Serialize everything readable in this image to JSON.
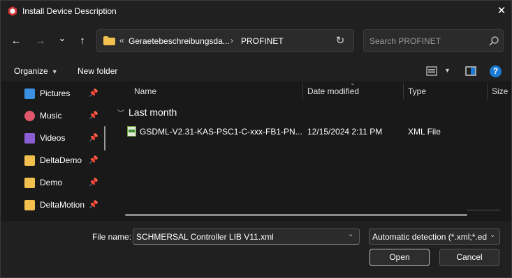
{
  "window": {
    "title": "Install Device Description",
    "close_glyph": "✕"
  },
  "nav": {
    "back_glyph": "←",
    "forward_glyph": "→",
    "recent_glyph": "⌄",
    "up_glyph": "↑"
  },
  "address": {
    "overflow_glyph": "«",
    "crumbs": [
      "Geraetebeschreibungsda...",
      "PROFINET"
    ],
    "separator_glyph": "›",
    "refresh_glyph": "↻"
  },
  "search": {
    "placeholder": "Search PROFINET"
  },
  "commandbar": {
    "organize_label": "Organize",
    "new_folder_label": "New folder",
    "help_label": "?"
  },
  "sidebar": {
    "items": [
      {
        "label": "Pictures",
        "icon": "pictures-icon",
        "color": "#3b8fe0"
      },
      {
        "label": "Music",
        "icon": "music-icon",
        "color": "#e0566b"
      },
      {
        "label": "Videos",
        "icon": "videos-icon",
        "color": "#8a5fd4"
      },
      {
        "label": "DeltaDemo",
        "icon": "folder-icon",
        "color": "#f2c04f"
      },
      {
        "label": "Demo",
        "icon": "folder-icon",
        "color": "#f2c04f"
      },
      {
        "label": "DeltaMotion",
        "icon": "folder-icon",
        "color": "#f2c04f"
      }
    ],
    "pin_glyph": "📌"
  },
  "columns": {
    "name": "Name",
    "date_modified": "Date modified",
    "type": "Type",
    "size": "Size"
  },
  "groups": [
    {
      "label": "Last month",
      "files": [
        {
          "name": "GSDML-V2.31-KAS-PSC1-C-xxx-FB1-PN...",
          "date_modified": "12/15/2024 2:11 PM",
          "type": "XML File",
          "icon": "xml-file-icon"
        }
      ]
    }
  ],
  "footer": {
    "file_name_label": "File name:",
    "file_name_value": "SCHMERSAL Controller LIB V11.xml",
    "filter_value": "Automatic detection (*.xml;*.edr",
    "open_label": "Open",
    "cancel_label": "Cancel"
  },
  "colors": {
    "background": "#202020",
    "content_background": "#191919",
    "accent": "#1a7ad4",
    "folder": "#f2c04f"
  }
}
